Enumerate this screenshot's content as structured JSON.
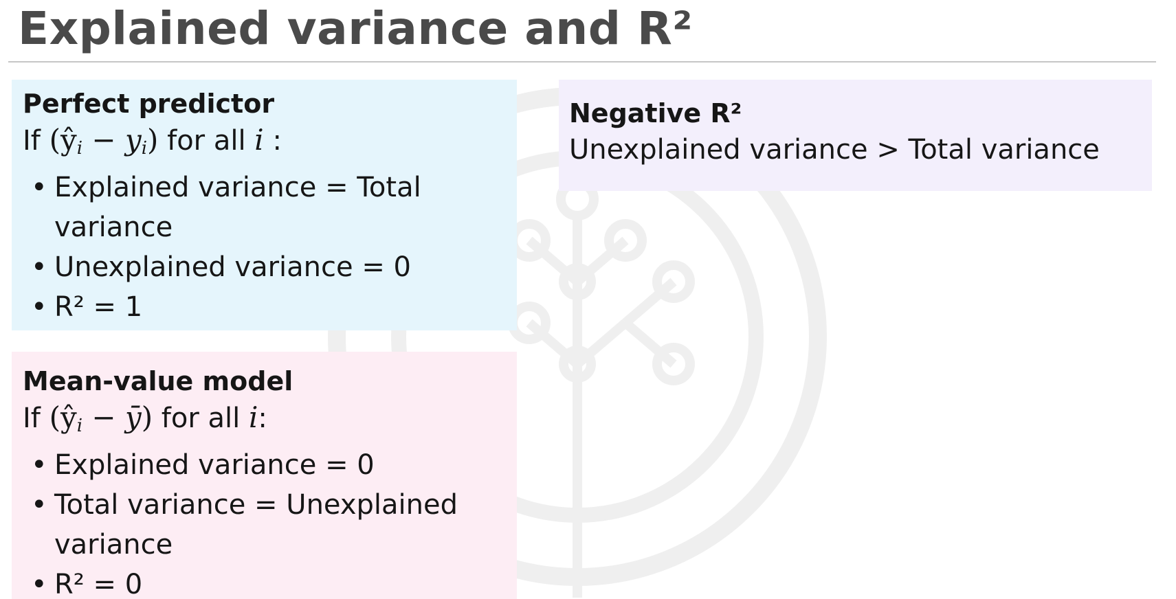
{
  "slide": {
    "title": "Explained variance and R²"
  },
  "perfect_predictor": {
    "heading": "Perfect predictor",
    "condition_prefix": "If ",
    "condition_suffix": " for all ",
    "condition_end": " :",
    "condition_var": "i",
    "bullets": [
      "Explained variance = Total variance",
      "Unexplained variance = 0",
      "R² = 1"
    ]
  },
  "mean_value_model": {
    "heading": "Mean-value model",
    "condition_prefix": "If ",
    "condition_suffix": " for all ",
    "condition_end": ":",
    "condition_var": "i",
    "bullets": [
      "Explained variance = 0",
      "Total variance = Unexplained variance",
      "R² = 0"
    ]
  },
  "negative_r2": {
    "heading": "Negative R²",
    "text": "Unexplained variance > Total variance"
  },
  "colors": {
    "blue_card": "#e5f5fc",
    "pink_card": "#fdedf4",
    "purple_card": "#f3effc",
    "title": "#4a4a4a"
  }
}
